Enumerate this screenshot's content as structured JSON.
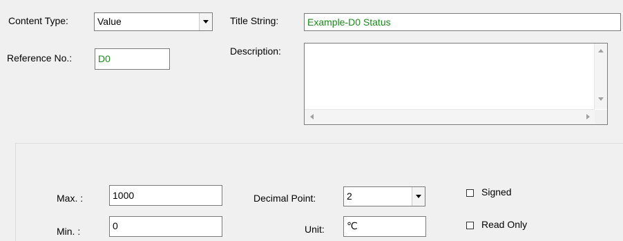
{
  "content_type": {
    "label": "Content Type:",
    "value": "Value"
  },
  "title_string": {
    "label": "Title String:",
    "value": "Example-D0 Status"
  },
  "reference_no": {
    "label": "Reference No.:",
    "value": "D0"
  },
  "description": {
    "label": "Description:",
    "value": ""
  },
  "max": {
    "label": "Max. :",
    "value": "1000"
  },
  "min": {
    "label": "Min. :",
    "value": "0"
  },
  "decimal_point": {
    "label": "Decimal Point:",
    "value": "2"
  },
  "unit": {
    "label": "Unit:",
    "value": "℃"
  },
  "signed": {
    "label": "Signed",
    "checked": false
  },
  "read_only": {
    "label": "Read Only",
    "checked": false
  },
  "colors": {
    "dialog_bg": "#f0f0f0",
    "field_bg": "#ffffff",
    "field_border": "#7a7a7a",
    "green_text": "#1a8a1a"
  },
  "icons": [
    "dropdown-arrow-icon",
    "scroll-up-icon",
    "scroll-down-icon",
    "scroll-left-icon",
    "scroll-right-icon"
  ]
}
